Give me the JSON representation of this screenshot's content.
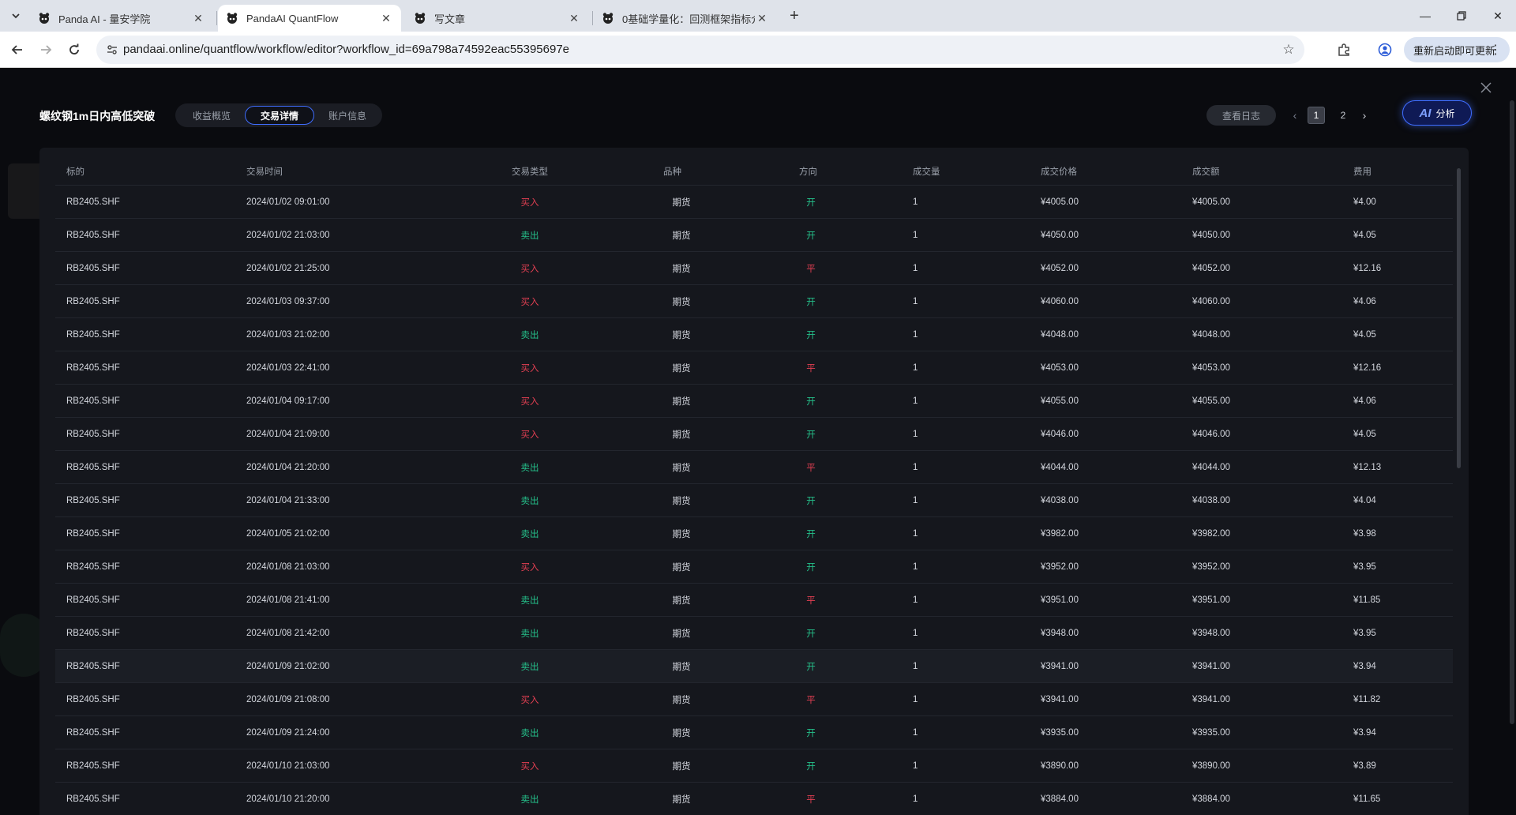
{
  "browser": {
    "tabs": [
      {
        "title": "Panda AI - 量安学院",
        "active": false
      },
      {
        "title": "PandaAI QuantFlow",
        "active": true
      },
      {
        "title": "写文章",
        "active": false
      },
      {
        "title": "0基础学量化：回测框架指标介绍",
        "active": false
      }
    ],
    "url": "pandaai.online/quantflow/workflow/editor?workflow_id=69a798a74592eac55395697e",
    "update_label": "重新启动即可更新"
  },
  "modal": {
    "title": "螺纹钢1m日内高低突破",
    "tabs": [
      {
        "label": "收益概览",
        "active": false
      },
      {
        "label": "交易详情",
        "active": true
      },
      {
        "label": "账户信息",
        "active": false
      }
    ],
    "log_button": "查看日志",
    "pagination": {
      "pages": [
        "1",
        "2"
      ],
      "current": "1"
    },
    "ai_button": {
      "mark": "AI",
      "label": "分析"
    }
  },
  "table": {
    "columns": [
      "标的",
      "交易时间",
      "交易类型",
      "品种",
      "方向",
      "成交量",
      "成交价格",
      "成交额",
      "费用"
    ],
    "rows": [
      [
        "RB2405.SHF",
        "2024/01/02 09:01:00",
        "买入",
        "期货",
        "开",
        "1",
        "¥4005.00",
        "¥4005.00",
        "¥4.00"
      ],
      [
        "RB2405.SHF",
        "2024/01/02 21:03:00",
        "卖出",
        "期货",
        "开",
        "1",
        "¥4050.00",
        "¥4050.00",
        "¥4.05"
      ],
      [
        "RB2405.SHF",
        "2024/01/02 21:25:00",
        "买入",
        "期货",
        "平",
        "1",
        "¥4052.00",
        "¥4052.00",
        "¥12.16"
      ],
      [
        "RB2405.SHF",
        "2024/01/03 09:37:00",
        "买入",
        "期货",
        "开",
        "1",
        "¥4060.00",
        "¥4060.00",
        "¥4.06"
      ],
      [
        "RB2405.SHF",
        "2024/01/03 21:02:00",
        "卖出",
        "期货",
        "开",
        "1",
        "¥4048.00",
        "¥4048.00",
        "¥4.05"
      ],
      [
        "RB2405.SHF",
        "2024/01/03 22:41:00",
        "买入",
        "期货",
        "平",
        "1",
        "¥4053.00",
        "¥4053.00",
        "¥12.16"
      ],
      [
        "RB2405.SHF",
        "2024/01/04 09:17:00",
        "买入",
        "期货",
        "开",
        "1",
        "¥4055.00",
        "¥4055.00",
        "¥4.06"
      ],
      [
        "RB2405.SHF",
        "2024/01/04 21:09:00",
        "买入",
        "期货",
        "开",
        "1",
        "¥4046.00",
        "¥4046.00",
        "¥4.05"
      ],
      [
        "RB2405.SHF",
        "2024/01/04 21:20:00",
        "卖出",
        "期货",
        "平",
        "1",
        "¥4044.00",
        "¥4044.00",
        "¥12.13"
      ],
      [
        "RB2405.SHF",
        "2024/01/04 21:33:00",
        "卖出",
        "期货",
        "开",
        "1",
        "¥4038.00",
        "¥4038.00",
        "¥4.04"
      ],
      [
        "RB2405.SHF",
        "2024/01/05 21:02:00",
        "卖出",
        "期货",
        "开",
        "1",
        "¥3982.00",
        "¥3982.00",
        "¥3.98"
      ],
      [
        "RB2405.SHF",
        "2024/01/08 21:03:00",
        "买入",
        "期货",
        "开",
        "1",
        "¥3952.00",
        "¥3952.00",
        "¥3.95"
      ],
      [
        "RB2405.SHF",
        "2024/01/08 21:41:00",
        "卖出",
        "期货",
        "平",
        "1",
        "¥3951.00",
        "¥3951.00",
        "¥11.85"
      ],
      [
        "RB2405.SHF",
        "2024/01/08 21:42:00",
        "卖出",
        "期货",
        "开",
        "1",
        "¥3948.00",
        "¥3948.00",
        "¥3.95"
      ],
      [
        "RB2405.SHF",
        "2024/01/09 21:02:00",
        "卖出",
        "期货",
        "开",
        "1",
        "¥3941.00",
        "¥3941.00",
        "¥3.94"
      ],
      [
        "RB2405.SHF",
        "2024/01/09 21:08:00",
        "买入",
        "期货",
        "平",
        "1",
        "¥3941.00",
        "¥3941.00",
        "¥11.82"
      ],
      [
        "RB2405.SHF",
        "2024/01/09 21:24:00",
        "卖出",
        "期货",
        "开",
        "1",
        "¥3935.00",
        "¥3935.00",
        "¥3.94"
      ],
      [
        "RB2405.SHF",
        "2024/01/10 21:03:00",
        "买入",
        "期货",
        "开",
        "1",
        "¥3890.00",
        "¥3890.00",
        "¥3.89"
      ],
      [
        "RB2405.SHF",
        "2024/01/10 21:20:00",
        "卖出",
        "期货",
        "平",
        "1",
        "¥3884.00",
        "¥3884.00",
        "¥11.65"
      ]
    ]
  },
  "colors": {
    "buy": "#e33f52",
    "sell": "#25c08a",
    "accent": "#3f6dff"
  }
}
